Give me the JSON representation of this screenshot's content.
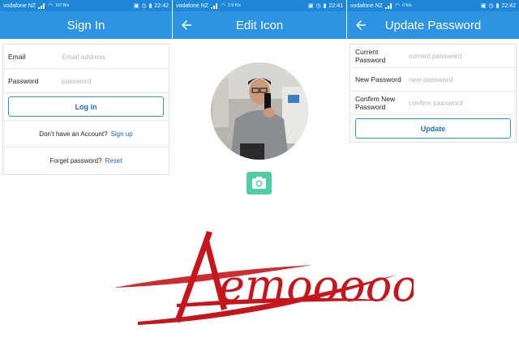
{
  "colors": {
    "appbar": "#2d93e3",
    "statusbar": "#1f87d9",
    "accent_link": "#1b5fc9",
    "camera_button": "#4ecda6",
    "logo_red": "#c4161c"
  },
  "signin": {
    "status": {
      "carrier": "vodafone NZ",
      "net_speed": "167 B/s",
      "time": "22:42"
    },
    "title": "Sign In",
    "email_label": "Email",
    "email_placeholder": "Email address",
    "password_label": "Password",
    "password_placeholder": "password",
    "login_label": "Log in",
    "no_account_text": "Don't have an Account?",
    "signup_label": "Sign up",
    "forgot_text": "Forget password?",
    "reset_label": "Reset"
  },
  "edit_icon": {
    "status": {
      "carrier": "vodafone NZ",
      "net_speed": "2.9 K/s",
      "time": "22:41"
    },
    "title": "Edit Icon",
    "avatar_icon": "profile-photo",
    "camera_icon": "camera-icon"
  },
  "update_password": {
    "status": {
      "carrier": "vodafone NZ",
      "net_speed": "0 K/s",
      "time": "22:42"
    },
    "title": "Update Password",
    "current_label": "Current Password",
    "current_placeholder": "current password",
    "new_label": "New Password",
    "new_placeholder": "new password",
    "confirm_label": "Confirm New Password",
    "confirm_placeholder": "confirm password",
    "update_label": "Update"
  },
  "logo_text": "Aemooooon"
}
